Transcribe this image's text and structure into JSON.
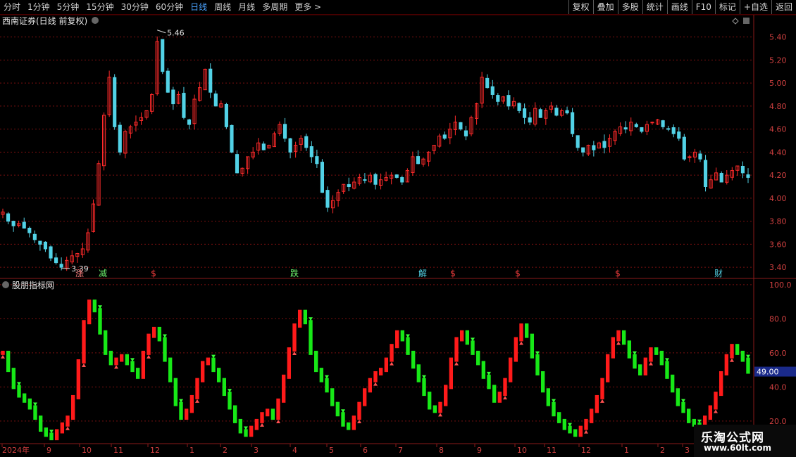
{
  "toolbar": {
    "tabs": [
      "分时",
      "1分钟",
      "5分钟",
      "15分钟",
      "30分钟",
      "60分钟",
      "日线",
      "周线",
      "月线",
      "多周期",
      "更多 >"
    ],
    "active_tab": "日线",
    "tools": [
      "复权",
      "叠加",
      "多股",
      "统计",
      "画线",
      "F10",
      "标记",
      "+自选",
      "返回"
    ]
  },
  "main_panel": {
    "title": "西南证券(日线 前复权)",
    "high_label": "5.46",
    "low_label": "3.39"
  },
  "indicator_panel": {
    "title": "股朋指标网",
    "current_value": "49.00"
  },
  "watermark": {
    "line1": "乐淘公式网",
    "line2": "www.60lt.com"
  },
  "colors": {
    "up": "#ff2a2a",
    "down": "#52d2e6",
    "ind_up": "#ff1a1a",
    "ind_down": "#17e817",
    "grid": "#7a1010"
  },
  "chart_data": [
    {
      "type": "candlestick",
      "ylim": [
        3.34,
        5.55
      ],
      "y_ticks": [
        3.4,
        3.6,
        3.8,
        4.0,
        4.2,
        4.4,
        4.6,
        4.8,
        5.0,
        5.2,
        5.4
      ],
      "x_tick_labels": [
        "2024年",
        "9",
        "10",
        "11",
        "12",
        "1",
        "2",
        "3",
        "4",
        "5",
        "6",
        "7",
        "8",
        "9",
        "10",
        "11",
        "12",
        "1",
        "2",
        "3"
      ],
      "close": [
        3.88,
        3.8,
        3.76,
        3.78,
        3.74,
        3.7,
        3.64,
        3.6,
        3.56,
        3.48,
        3.44,
        3.4,
        3.46,
        3.5,
        3.52,
        3.56,
        3.7,
        3.95,
        4.3,
        4.72,
        5.05,
        4.62,
        4.4,
        4.58,
        4.62,
        4.66,
        4.7,
        4.76,
        4.9,
        5.36,
        5.1,
        4.92,
        4.82,
        4.9,
        4.7,
        4.64,
        4.86,
        4.96,
        5.12,
        4.92,
        4.8,
        4.82,
        4.62,
        4.4,
        4.22,
        4.26,
        4.36,
        4.4,
        4.48,
        4.42,
        4.46,
        4.56,
        4.64,
        4.52,
        4.4,
        4.46,
        4.52,
        4.44,
        4.36,
        4.3,
        4.05,
        3.92,
        3.98,
        4.05,
        4.12,
        4.1,
        4.14,
        4.18,
        4.16,
        4.2,
        4.12,
        4.16,
        4.18,
        4.2,
        4.18,
        4.14,
        4.24,
        4.36,
        4.3,
        4.34,
        4.4,
        4.46,
        4.54,
        4.52,
        4.6,
        4.66,
        4.6,
        4.54,
        4.7,
        4.82,
        5.05,
        4.96,
        4.9,
        4.84,
        4.88,
        4.8,
        4.84,
        4.76,
        4.7,
        4.66,
        4.78,
        4.7,
        4.76,
        4.8,
        4.72,
        4.76,
        4.74,
        4.56,
        4.44,
        4.4,
        4.46,
        4.42,
        4.48,
        4.44,
        4.52,
        4.58,
        4.62,
        4.6,
        4.66,
        4.62,
        4.58,
        4.64,
        4.66,
        4.68,
        4.62,
        4.6,
        4.56,
        4.52,
        4.34,
        4.36,
        4.4,
        4.34,
        4.1,
        4.16,
        4.22,
        4.14,
        4.2,
        4.24,
        4.28,
        4.22,
        4.18
      ],
      "high_mark": 5.46,
      "low_mark": 3.39,
      "signal_labels": [
        "涨",
        "减",
        "$",
        "跌",
        "解",
        "$",
        "$",
        "$",
        "财"
      ]
    },
    {
      "type": "oscillator",
      "ylim": [
        8,
        102
      ],
      "y_ticks": [
        20.0,
        40.0,
        60.0,
        80.0,
        100.0
      ],
      "current_value": 49.0,
      "values": [
        60,
        50,
        40,
        35,
        32,
        28,
        22,
        15,
        12,
        10,
        14,
        18,
        22,
        34,
        55,
        78,
        90,
        85,
        72,
        60,
        54,
        56,
        58,
        54,
        50,
        46,
        60,
        70,
        74,
        68,
        56,
        44,
        30,
        22,
        26,
        34,
        44,
        54,
        56,
        50,
        44,
        36,
        28,
        20,
        14,
        12,
        16,
        20,
        24,
        26,
        22,
        32,
        46,
        62,
        76,
        84,
        78,
        60,
        50,
        44,
        38,
        30,
        24,
        18,
        16,
        22,
        30,
        38,
        44,
        48,
        50,
        56,
        64,
        72,
        68,
        60,
        52,
        44,
        36,
        28,
        26,
        30,
        40,
        56,
        68,
        72,
        66,
        60,
        54,
        46,
        40,
        32,
        36,
        44,
        56,
        68,
        76,
        70,
        58,
        48,
        38,
        30,
        24,
        20,
        16,
        14,
        12,
        16,
        20,
        26,
        34,
        44,
        58,
        68,
        72,
        66,
        58,
        52,
        48,
        56,
        62,
        60,
        54,
        46,
        38,
        30,
        26,
        20,
        18,
        16,
        22,
        28,
        36,
        48,
        58,
        64,
        60,
        56,
        49
      ]
    }
  ]
}
